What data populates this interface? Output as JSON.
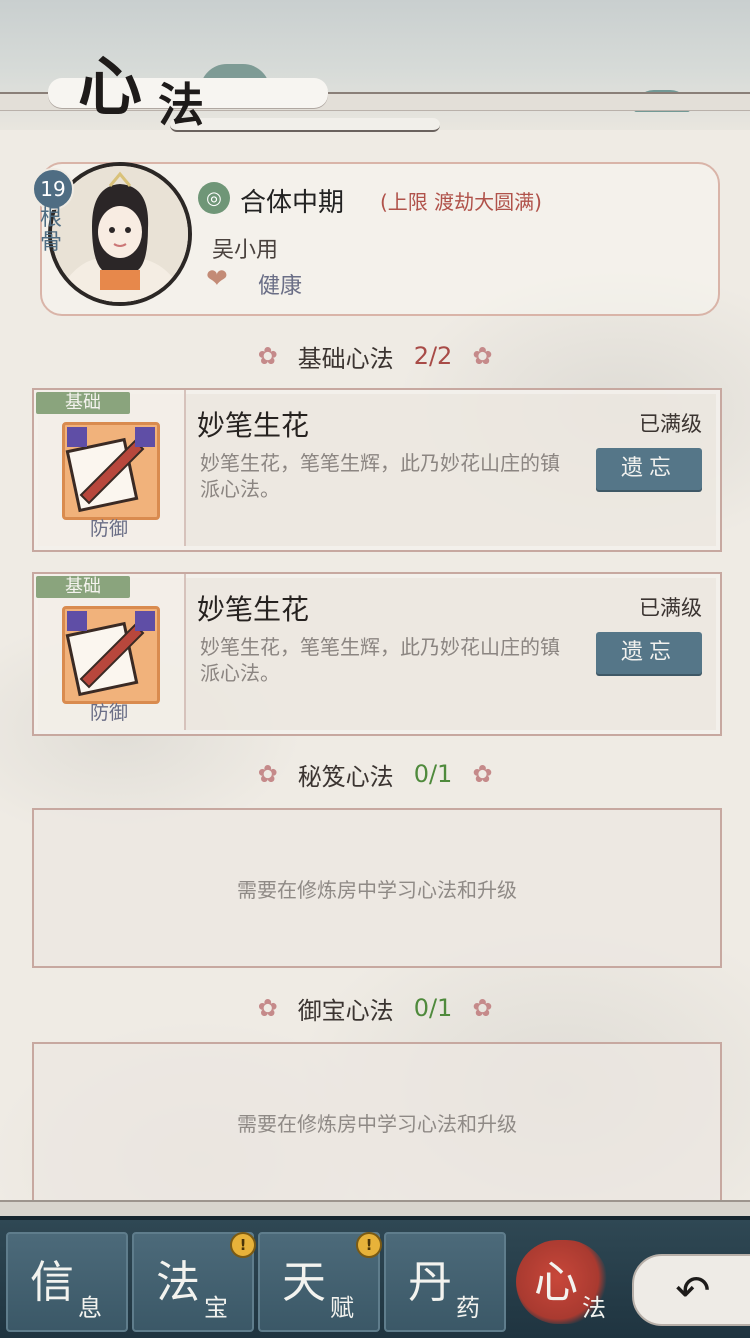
{
  "header": {
    "title_big": "心",
    "title_small": "法"
  },
  "profile": {
    "level": "19",
    "level_label": "根骨",
    "realm": "合体中期",
    "realm_limit": "(上限 渡劫大圆满)",
    "name": "吴小用",
    "status": "健康"
  },
  "sections": [
    {
      "title": "基础心法",
      "count": "2/2"
    },
    {
      "title": "秘笈心法",
      "count": "0/1"
    },
    {
      "title": "御宝心法",
      "count": "0/1"
    }
  ],
  "techniques": [
    {
      "tag": "基础",
      "name": "妙笔生花",
      "desc": "妙笔生花，笔笔生辉，此乃妙花山庄的镇派心法。",
      "type": "防御",
      "level_status": "已满级",
      "action": "遗忘"
    },
    {
      "tag": "基础",
      "name": "妙笔生花",
      "desc": "妙笔生花，笔笔生辉，此乃妙花山庄的镇派心法。",
      "type": "防御",
      "level_status": "已满级",
      "action": "遗忘"
    }
  ],
  "empty_text": "需要在修炼房中学习心法和升级",
  "nav": [
    {
      "big": "信",
      "small": "息",
      "alert": ""
    },
    {
      "big": "法",
      "small": "宝",
      "alert": "!"
    },
    {
      "big": "天",
      "small": "赋",
      "alert": "!"
    },
    {
      "big": "丹",
      "small": "药",
      "alert": ""
    },
    {
      "big": "心",
      "small": "法",
      "alert": ""
    }
  ],
  "colors": {
    "accent": "#557688",
    "nav_bg": "#2f4854",
    "active": "#c8473a",
    "tag_green": "#8aa47d"
  },
  "icons": {
    "back": "back-arrow-icon",
    "heart": "heart-plus-icon",
    "realm": "realm-swirl-icon"
  }
}
